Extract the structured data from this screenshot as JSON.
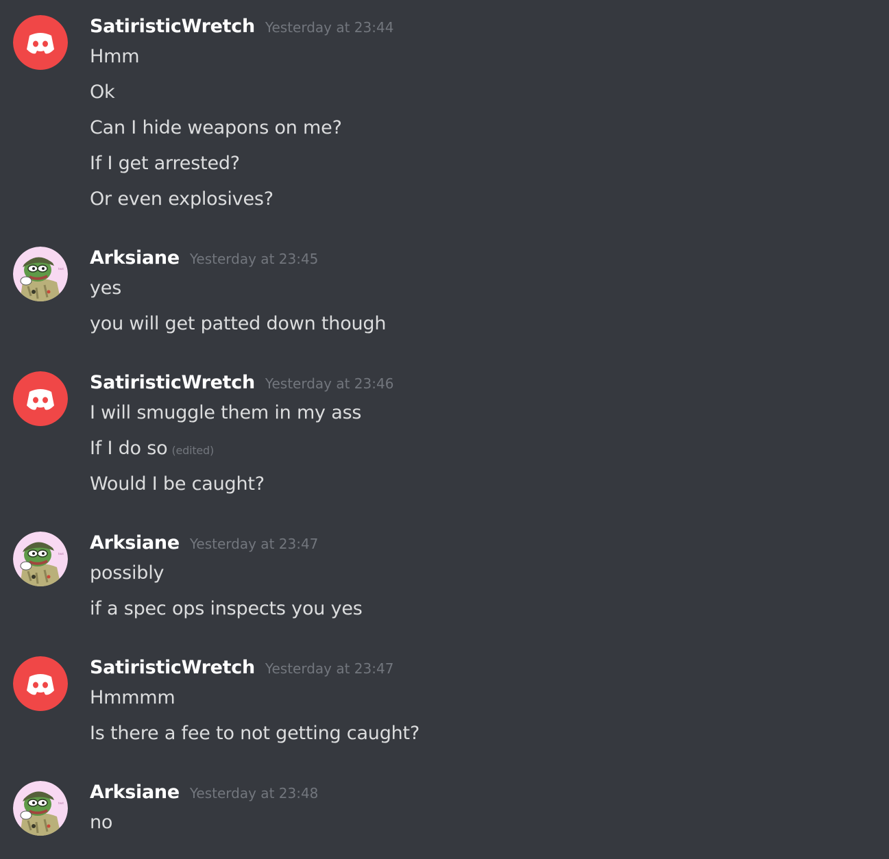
{
  "colors": {
    "background": "#36393f",
    "username": "#ffffff",
    "message_text": "#dcddde",
    "timestamp": "#72767d",
    "discord_avatar_bg": "#f04747"
  },
  "messages": [
    {
      "author": "SatiristicWretch",
      "avatar": "discord-logo-icon",
      "timestamp": "Yesterday at 23:44",
      "lines": [
        "Hmm",
        "Ok",
        "Can I hide weapons on me?",
        "If I get arrested?",
        "Or even explosives?"
      ]
    },
    {
      "author": "Arksiane",
      "avatar": "pepe-soldier-icon",
      "timestamp": "Yesterday at 23:45",
      "lines": [
        "yes",
        "you will get patted down though"
      ]
    },
    {
      "author": "SatiristicWretch",
      "avatar": "discord-logo-icon",
      "timestamp": "Yesterday at 23:46",
      "lines": [
        "I will smuggle them in my ass",
        "If I do so",
        "Would I be caught?"
      ],
      "edited_label": "(edited)"
    },
    {
      "author": "Arksiane",
      "avatar": "pepe-soldier-icon",
      "timestamp": "Yesterday at 23:47",
      "lines": [
        "possibly",
        "if a spec ops inspects you yes"
      ]
    },
    {
      "author": "SatiristicWretch",
      "avatar": "discord-logo-icon",
      "timestamp": "Yesterday at 23:47",
      "lines": [
        "Hmmmm",
        "Is there a fee to not getting caught?"
      ]
    },
    {
      "author": "Arksiane",
      "avatar": "pepe-soldier-icon",
      "timestamp": "Yesterday at 23:48",
      "lines": [
        "no"
      ]
    }
  ]
}
